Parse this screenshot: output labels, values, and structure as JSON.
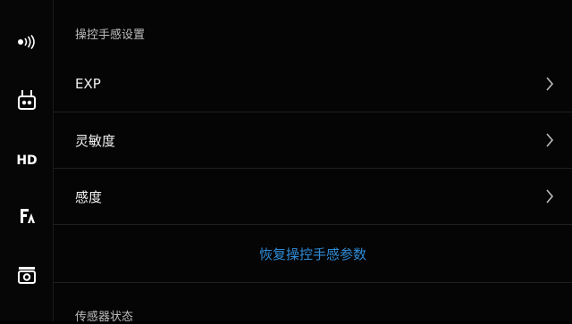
{
  "sidebar": {
    "items": [
      {
        "icon": "signal-icon"
      },
      {
        "icon": "remote-controller-icon"
      },
      {
        "icon": "hd-icon",
        "label": "HD"
      },
      {
        "icon": "flight-assist-icon"
      },
      {
        "icon": "camera-icon"
      }
    ]
  },
  "settings": {
    "section_title": "操控手感设置",
    "rows": [
      {
        "label": "EXP"
      },
      {
        "label": "灵敏度"
      },
      {
        "label": "感度"
      }
    ],
    "reset_label": "恢复操控手感参数",
    "next_section_title": "传感器状态"
  },
  "colors": {
    "accent": "#2f8bd6",
    "background": "#000000",
    "sidebar": "#060606"
  }
}
